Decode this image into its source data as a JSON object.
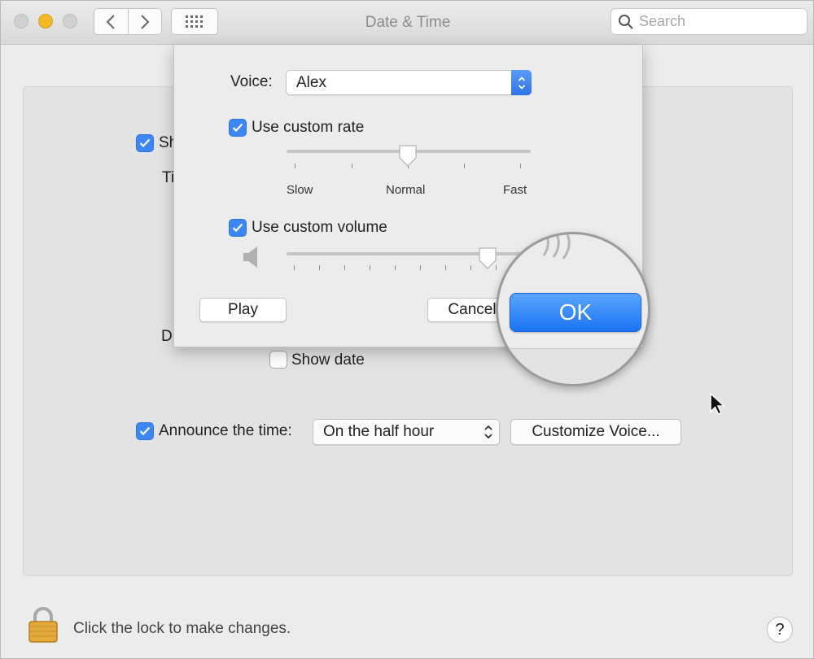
{
  "window": {
    "title": "Date & Time"
  },
  "toolbar": {
    "back_icon": "chevron-left-icon",
    "forward_icon": "chevron-right-icon",
    "grid_icon": "grid-icon",
    "search_placeholder": "Search"
  },
  "panel": {
    "show_clock_label_partial": "Sh",
    "time_options_label_partial": "Ti",
    "date_options_label_partial": "D",
    "show_date_label": "Show date",
    "show_date_checked": false,
    "announce_label": "Announce the time:",
    "announce_checked": true,
    "announce_value": "On the half hour",
    "customize_voice_label": "Customize Voice..."
  },
  "dialog": {
    "voice_label": "Voice:",
    "voice_value": "Alex",
    "custom_rate_label": "Use custom rate",
    "custom_rate_checked": true,
    "rate_slider_value": 0.5,
    "rate_labels": [
      "Slow",
      "Normal",
      "Fast"
    ],
    "custom_volume_label": "Use custom volume",
    "custom_volume_checked": true,
    "volume_slider_value": 0.83,
    "play_label": "Play",
    "cancel_label": "Cancel",
    "ok_label": "OK"
  },
  "footer": {
    "lock_text": "Click the lock to make changes.",
    "help_label": "?"
  },
  "colors": {
    "accent": "#3c87f4",
    "ok_button": "#1b74f4",
    "minimize": "#f5b826"
  }
}
